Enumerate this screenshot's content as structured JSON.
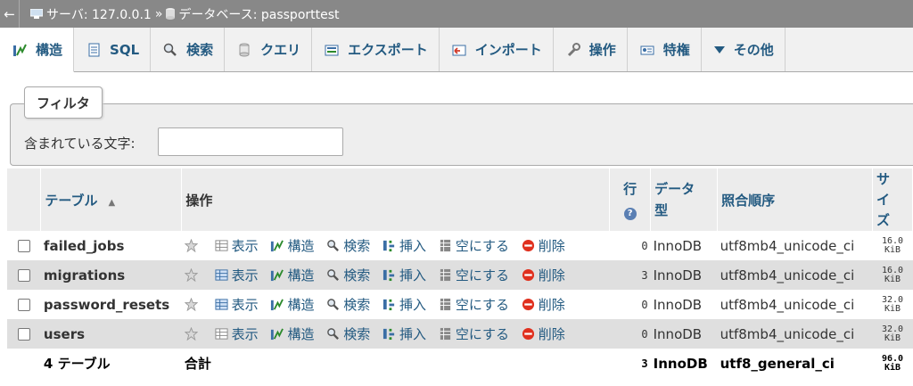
{
  "breadcrumb": {
    "back": "←",
    "server": "サーバ: 127.0.0.1",
    "separator": "»",
    "database": "データベース: passporttest"
  },
  "tabs": [
    {
      "label": "構造",
      "icon": "structure-icon",
      "active": true
    },
    {
      "label": "SQL",
      "icon": "sql-icon"
    },
    {
      "label": "検索",
      "icon": "search-icon"
    },
    {
      "label": "クエリ",
      "icon": "query-icon"
    },
    {
      "label": "エクスポート",
      "icon": "export-icon"
    },
    {
      "label": "インポート",
      "icon": "import-icon"
    },
    {
      "label": "操作",
      "icon": "wrench-icon"
    },
    {
      "label": "特権",
      "icon": "privileges-icon"
    },
    {
      "label": "その他",
      "icon": "dropdown-icon"
    }
  ],
  "filter": {
    "legend": "フィルタ",
    "label": "含まれている文字:",
    "value": ""
  },
  "table_headers": {
    "table": "テーブル",
    "sort": "▲",
    "actions": "操作",
    "rows": "行",
    "help": "?",
    "type": "データ型",
    "collation": "照合順序",
    "size": "サイズ"
  },
  "actions": {
    "browse": "表示",
    "structure": "構造",
    "search": "検索",
    "insert": "挿入",
    "empty": "空にする",
    "drop": "削除"
  },
  "rows": [
    {
      "name": "failed_jobs",
      "rows": "0",
      "engine": "InnoDB",
      "collation": "utf8mb4_unicode_ci",
      "size_num": "16.0",
      "size_unit": "KiB"
    },
    {
      "name": "migrations",
      "rows": "3",
      "engine": "InnoDB",
      "collation": "utf8mb4_unicode_ci",
      "size_num": "16.0",
      "size_unit": "KiB"
    },
    {
      "name": "password_resets",
      "rows": "0",
      "engine": "InnoDB",
      "collation": "utf8mb4_unicode_ci",
      "size_num": "32.0",
      "size_unit": "KiB"
    },
    {
      "name": "users",
      "rows": "0",
      "engine": "InnoDB",
      "collation": "utf8mb4_unicode_ci",
      "size_num": "32.0",
      "size_unit": "KiB"
    }
  ],
  "footer": {
    "count": "4 テーブル",
    "total": "合計",
    "rows": "3",
    "engine": "InnoDB",
    "collation": "utf8_general_ci",
    "size_num": "96.0",
    "size_unit": "KiB"
  },
  "colors": {
    "link": "#235a81",
    "topbar": "#888888",
    "drop": "#e0301e"
  }
}
